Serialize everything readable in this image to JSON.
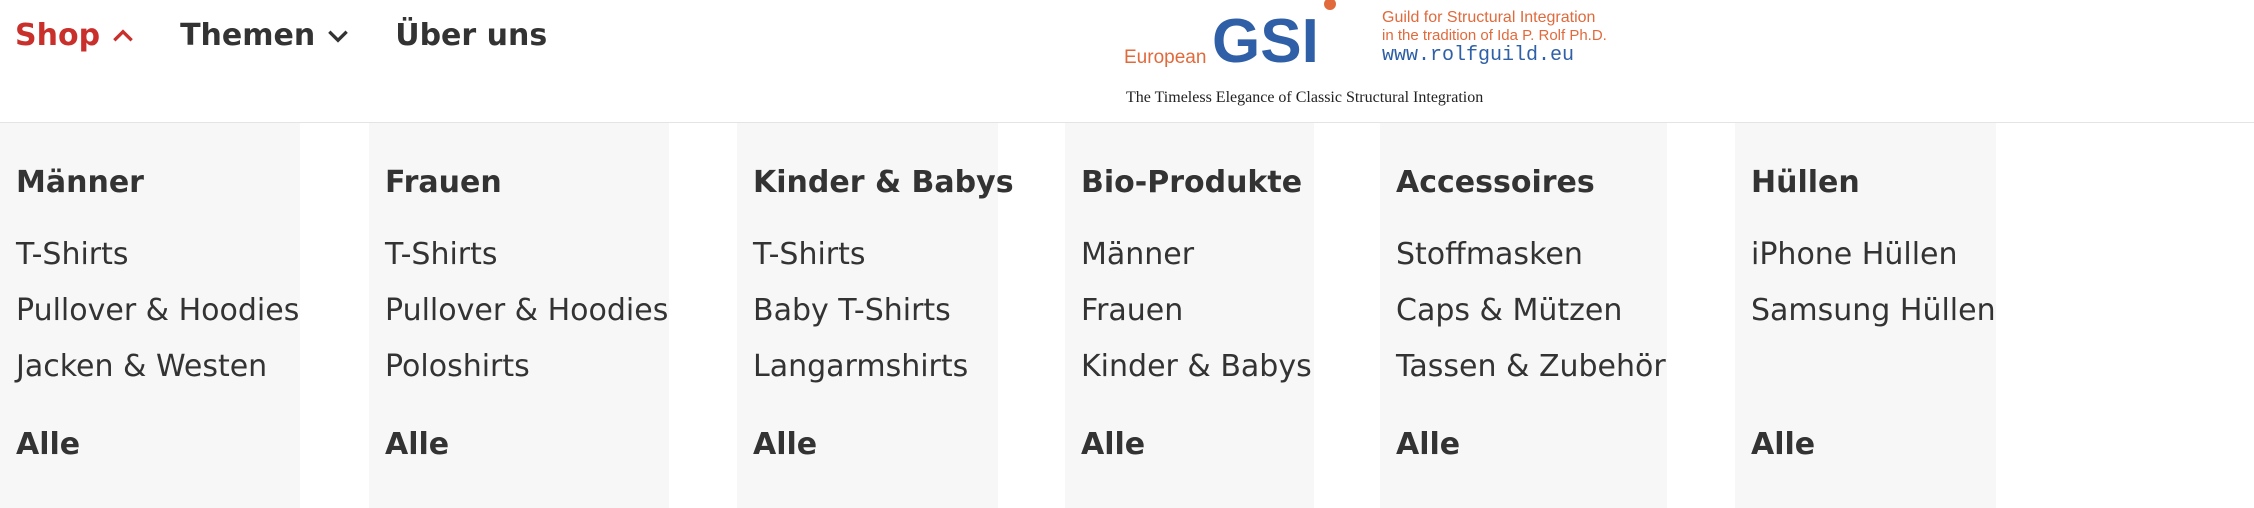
{
  "nav": {
    "items": [
      {
        "label": "Shop",
        "state": "active"
      },
      {
        "label": "Themen",
        "state": "collapsed"
      },
      {
        "label": "Über uns",
        "state": "plain"
      }
    ],
    "active_color": "#c9302c"
  },
  "logo": {
    "prefix": "European",
    "letters": "GSI",
    "line1": "Guild for Structural Integration",
    "line2": "in the tradition of Ida P. Rolf Ph.D.",
    "url": "www.rolfguild.eu",
    "tagline": "The Timeless Elegance of Classic Structural Integration",
    "colors": {
      "blue": "#2f5fa6",
      "orange": "#e06a3c"
    }
  },
  "menu": {
    "columns": [
      {
        "title": "Männer",
        "links": [
          "T-Shirts",
          "Pullover & Hoodies",
          "Jacken & Westen"
        ],
        "all": "Alle"
      },
      {
        "title": "Frauen",
        "links": [
          "T-Shirts",
          "Pullover & Hoodies",
          "Poloshirts"
        ],
        "all": "Alle"
      },
      {
        "title": "Kinder & Babys",
        "links": [
          "T-Shirts",
          "Baby T-Shirts",
          "Langarmshirts"
        ],
        "all": "Alle"
      },
      {
        "title": "Bio-Produkte",
        "links": [
          "Männer",
          "Frauen",
          "Kinder & Babys"
        ],
        "all": "Alle"
      },
      {
        "title": "Accessoires",
        "links": [
          "Stoffmasken",
          "Caps & Mützen",
          "Tassen & Zubehör"
        ],
        "all": "Alle"
      },
      {
        "title": "Hüllen",
        "links": [
          "iPhone Hüllen",
          "Samsung Hüllen"
        ],
        "all": "Alle"
      }
    ]
  }
}
